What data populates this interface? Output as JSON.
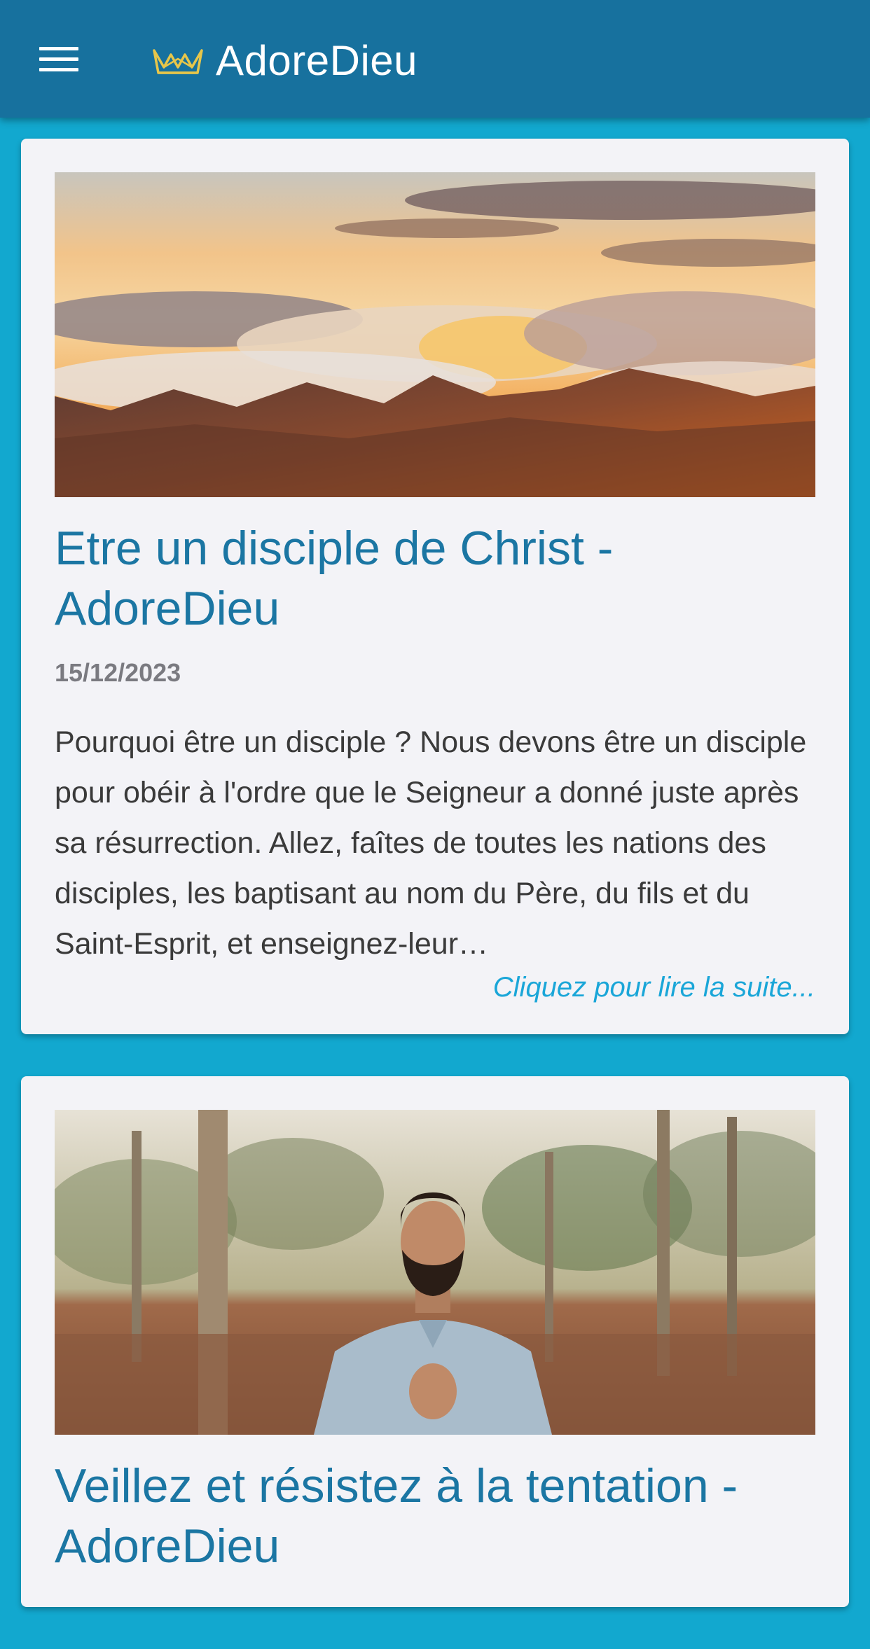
{
  "appbar": {
    "brand": "AdoreDieu",
    "brand_color": "#17719e",
    "menu_icon": "hamburger-menu-icon",
    "logo_icon": "crown-icon"
  },
  "background_color": "#12a8cf",
  "posts": [
    {
      "title": "Etre un disciple de Christ - AdoreDieu",
      "date": "15/12/2023",
      "excerpt": "Pourquoi être un disciple ? Nous devons être un disciple pour obéir à l'ordre que le Seigneur a donné juste après sa résurrection. Allez, faîtes de toutes les nations des disciples, les baptisant au nom du Père, du fils et du Saint-Esprit, et enseignez-leur…",
      "read_more": "Cliquez pour lire la suite..."
    },
    {
      "title": "Veillez et résistez à la tentation - AdoreDieu"
    }
  ]
}
